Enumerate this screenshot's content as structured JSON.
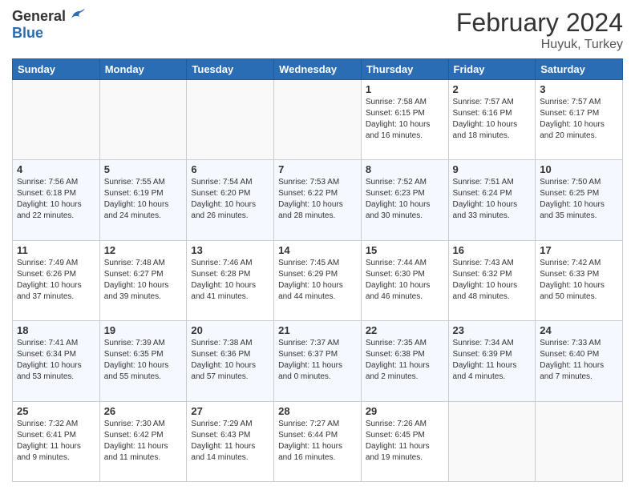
{
  "header": {
    "logo_general": "General",
    "logo_blue": "Blue",
    "title": "February 2024",
    "location": "Huyuk, Turkey"
  },
  "weekdays": [
    "Sunday",
    "Monday",
    "Tuesday",
    "Wednesday",
    "Thursday",
    "Friday",
    "Saturday"
  ],
  "weeks": [
    [
      {
        "day": "",
        "info": ""
      },
      {
        "day": "",
        "info": ""
      },
      {
        "day": "",
        "info": ""
      },
      {
        "day": "",
        "info": ""
      },
      {
        "day": "1",
        "info": "Sunrise: 7:58 AM\nSunset: 6:15 PM\nDaylight: 10 hours\nand 16 minutes."
      },
      {
        "day": "2",
        "info": "Sunrise: 7:57 AM\nSunset: 6:16 PM\nDaylight: 10 hours\nand 18 minutes."
      },
      {
        "day": "3",
        "info": "Sunrise: 7:57 AM\nSunset: 6:17 PM\nDaylight: 10 hours\nand 20 minutes."
      }
    ],
    [
      {
        "day": "4",
        "info": "Sunrise: 7:56 AM\nSunset: 6:18 PM\nDaylight: 10 hours\nand 22 minutes."
      },
      {
        "day": "5",
        "info": "Sunrise: 7:55 AM\nSunset: 6:19 PM\nDaylight: 10 hours\nand 24 minutes."
      },
      {
        "day": "6",
        "info": "Sunrise: 7:54 AM\nSunset: 6:20 PM\nDaylight: 10 hours\nand 26 minutes."
      },
      {
        "day": "7",
        "info": "Sunrise: 7:53 AM\nSunset: 6:22 PM\nDaylight: 10 hours\nand 28 minutes."
      },
      {
        "day": "8",
        "info": "Sunrise: 7:52 AM\nSunset: 6:23 PM\nDaylight: 10 hours\nand 30 minutes."
      },
      {
        "day": "9",
        "info": "Sunrise: 7:51 AM\nSunset: 6:24 PM\nDaylight: 10 hours\nand 33 minutes."
      },
      {
        "day": "10",
        "info": "Sunrise: 7:50 AM\nSunset: 6:25 PM\nDaylight: 10 hours\nand 35 minutes."
      }
    ],
    [
      {
        "day": "11",
        "info": "Sunrise: 7:49 AM\nSunset: 6:26 PM\nDaylight: 10 hours\nand 37 minutes."
      },
      {
        "day": "12",
        "info": "Sunrise: 7:48 AM\nSunset: 6:27 PM\nDaylight: 10 hours\nand 39 minutes."
      },
      {
        "day": "13",
        "info": "Sunrise: 7:46 AM\nSunset: 6:28 PM\nDaylight: 10 hours\nand 41 minutes."
      },
      {
        "day": "14",
        "info": "Sunrise: 7:45 AM\nSunset: 6:29 PM\nDaylight: 10 hours\nand 44 minutes."
      },
      {
        "day": "15",
        "info": "Sunrise: 7:44 AM\nSunset: 6:30 PM\nDaylight: 10 hours\nand 46 minutes."
      },
      {
        "day": "16",
        "info": "Sunrise: 7:43 AM\nSunset: 6:32 PM\nDaylight: 10 hours\nand 48 minutes."
      },
      {
        "day": "17",
        "info": "Sunrise: 7:42 AM\nSunset: 6:33 PM\nDaylight: 10 hours\nand 50 minutes."
      }
    ],
    [
      {
        "day": "18",
        "info": "Sunrise: 7:41 AM\nSunset: 6:34 PM\nDaylight: 10 hours\nand 53 minutes."
      },
      {
        "day": "19",
        "info": "Sunrise: 7:39 AM\nSunset: 6:35 PM\nDaylight: 10 hours\nand 55 minutes."
      },
      {
        "day": "20",
        "info": "Sunrise: 7:38 AM\nSunset: 6:36 PM\nDaylight: 10 hours\nand 57 minutes."
      },
      {
        "day": "21",
        "info": "Sunrise: 7:37 AM\nSunset: 6:37 PM\nDaylight: 11 hours\nand 0 minutes."
      },
      {
        "day": "22",
        "info": "Sunrise: 7:35 AM\nSunset: 6:38 PM\nDaylight: 11 hours\nand 2 minutes."
      },
      {
        "day": "23",
        "info": "Sunrise: 7:34 AM\nSunset: 6:39 PM\nDaylight: 11 hours\nand 4 minutes."
      },
      {
        "day": "24",
        "info": "Sunrise: 7:33 AM\nSunset: 6:40 PM\nDaylight: 11 hours\nand 7 minutes."
      }
    ],
    [
      {
        "day": "25",
        "info": "Sunrise: 7:32 AM\nSunset: 6:41 PM\nDaylight: 11 hours\nand 9 minutes."
      },
      {
        "day": "26",
        "info": "Sunrise: 7:30 AM\nSunset: 6:42 PM\nDaylight: 11 hours\nand 11 minutes."
      },
      {
        "day": "27",
        "info": "Sunrise: 7:29 AM\nSunset: 6:43 PM\nDaylight: 11 hours\nand 14 minutes."
      },
      {
        "day": "28",
        "info": "Sunrise: 7:27 AM\nSunset: 6:44 PM\nDaylight: 11 hours\nand 16 minutes."
      },
      {
        "day": "29",
        "info": "Sunrise: 7:26 AM\nSunset: 6:45 PM\nDaylight: 11 hours\nand 19 minutes."
      },
      {
        "day": "",
        "info": ""
      },
      {
        "day": "",
        "info": ""
      }
    ]
  ]
}
